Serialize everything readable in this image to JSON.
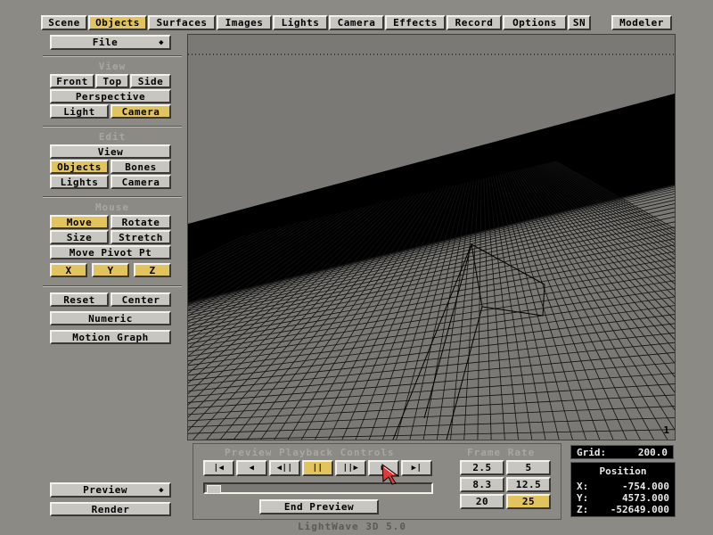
{
  "menu": {
    "tabs": [
      "Scene",
      "Objects",
      "Surfaces",
      "Images",
      "Lights",
      "Camera",
      "Effects",
      "Record",
      "Options",
      "SN"
    ],
    "modeler": "Modeler",
    "active_tab": "Objects"
  },
  "left": {
    "file": "File",
    "view_title": "View",
    "view": {
      "front": "Front",
      "top": "Top",
      "side": "Side",
      "perspective": "Perspective",
      "light": "Light",
      "camera": "Camera"
    },
    "edit_title": "Edit",
    "edit": {
      "view": "View",
      "objects": "Objects",
      "bones": "Bones",
      "lights": "Lights",
      "camera": "Camera"
    },
    "mouse_title": "Mouse",
    "mouse": {
      "move": "Move",
      "rotate": "Rotate",
      "size": "Size",
      "stretch": "Stretch",
      "move_pivot": "Move Pivot Pt",
      "x": "X",
      "y": "Y",
      "z": "Z"
    },
    "reset": "Reset",
    "center": "Center",
    "numeric": "Numeric",
    "motion_graph": "Motion Graph",
    "preview": "Preview",
    "render": "Render"
  },
  "viewport": {
    "corner_label": "1"
  },
  "preview": {
    "title": "Preview Playback Controls",
    "end_preview": "End Preview",
    "controls": [
      "first",
      "back",
      "step-back",
      "pause",
      "step-forward",
      "forward",
      "last"
    ]
  },
  "frame_rate": {
    "title": "Frame Rate",
    "values": [
      "2.5",
      "5",
      "8.3",
      "12.5",
      "20",
      "25"
    ],
    "selected": "25"
  },
  "grid": {
    "label": "Grid:",
    "value": "200.0"
  },
  "position": {
    "title": "Position",
    "x_label": "X:",
    "x": "-754.000",
    "y_label": "Y:",
    "y": "4573.000",
    "z_label": "Z:",
    "z": "-52649.000"
  },
  "footer": "LightWave 3D 5.0",
  "colors": {
    "background": "#8c8a84",
    "button": "#c8c6c0",
    "selected": "#e2c45e",
    "viewport": "#7a7975"
  }
}
